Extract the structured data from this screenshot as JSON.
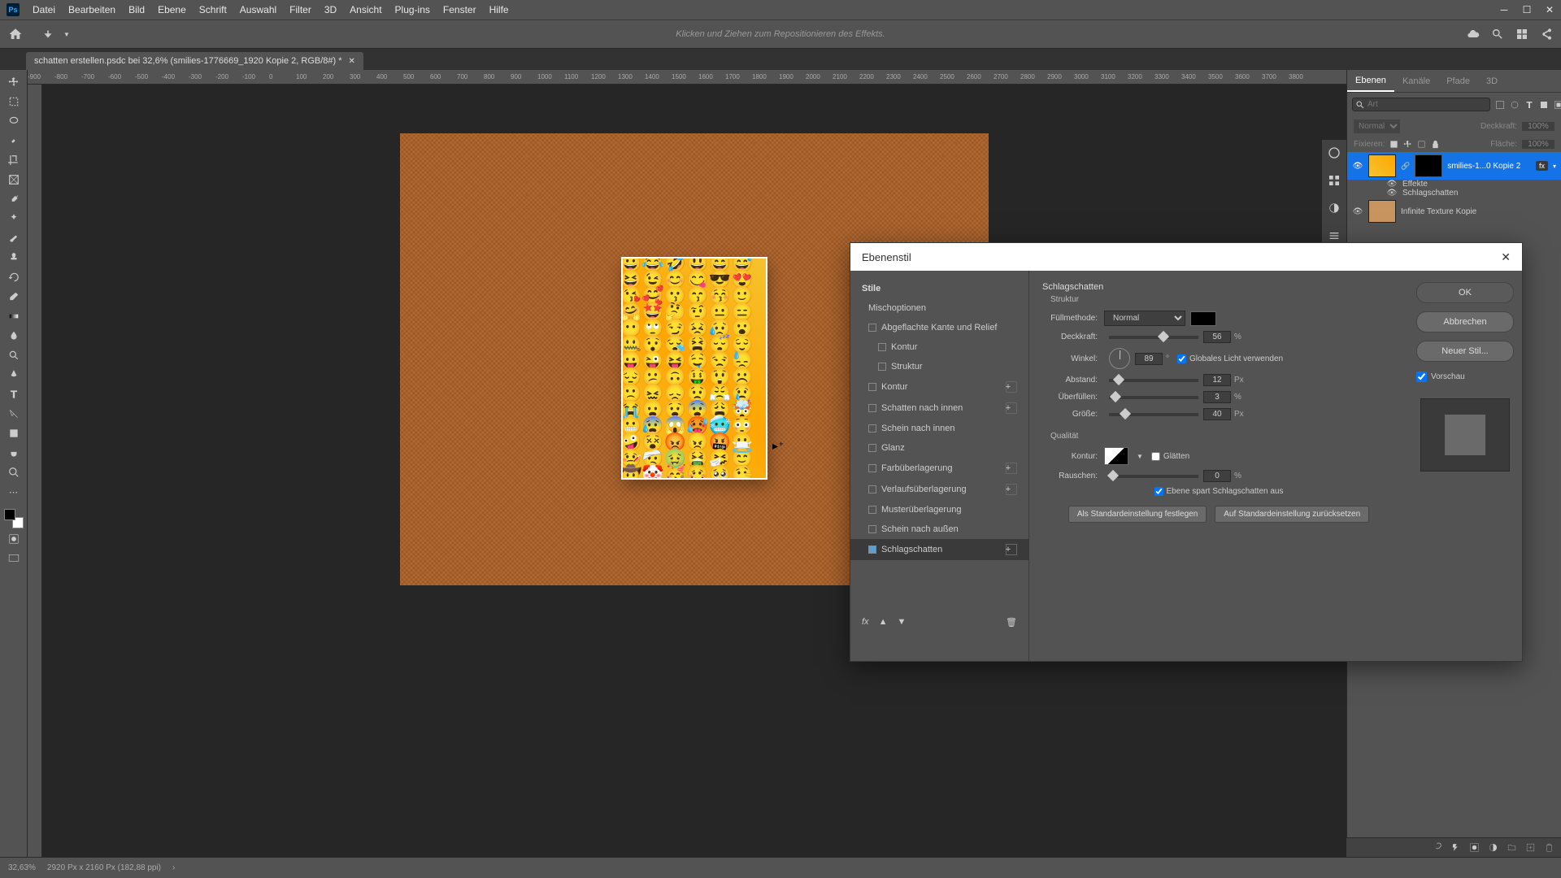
{
  "menu": {
    "items": [
      "Datei",
      "Bearbeiten",
      "Bild",
      "Ebene",
      "Schrift",
      "Auswahl",
      "Filter",
      "3D",
      "Ansicht",
      "Plug-ins",
      "Fenster",
      "Hilfe"
    ]
  },
  "hint": "Klicken und Ziehen zum Repositionieren des Effekts.",
  "doc_tab": {
    "title": "schatten erstellen.psdc bei 32,6% (smilies-1776669_1920 Kopie 2, RGB/8#) *"
  },
  "ruler_ticks": [
    "-900",
    "-800",
    "-700",
    "-600",
    "-500",
    "-400",
    "-300",
    "-200",
    "-100",
    "0",
    "100",
    "200",
    "300",
    "400",
    "500",
    "600",
    "700",
    "800",
    "900",
    "1000",
    "1100",
    "1200",
    "1300",
    "1400",
    "1500",
    "1600",
    "1700",
    "1800",
    "1900",
    "2000",
    "2100",
    "2200",
    "2300",
    "2400",
    "2500",
    "2600",
    "2700",
    "2800",
    "2900",
    "3000",
    "3100",
    "3200",
    "3300",
    "3400",
    "3500",
    "3600",
    "3700",
    "3800"
  ],
  "panels": {
    "tabs": [
      "Ebenen",
      "Kanäle",
      "Pfade",
      "3D"
    ],
    "search_placeholder": "Art",
    "blend_mode": "Normal",
    "opacity_label": "Deckkraft:",
    "opacity_value": "100%",
    "lock_label": "Fixieren:",
    "fill_label": "Fläche:",
    "fill_value": "100%",
    "layers": [
      {
        "name": "smilies-1...0 Kopie 2",
        "fx": "fx"
      },
      {
        "effect_header": "Effekte"
      },
      {
        "effect_item": "Schlagschatten"
      },
      {
        "name": "Infinite Texture Kopie"
      }
    ]
  },
  "dialog": {
    "title": "Ebenenstil",
    "left": {
      "header": "Stile",
      "mix": "Mischoptionen",
      "items": [
        {
          "label": "Abgeflachte Kante und Relief"
        },
        {
          "label": "Kontur",
          "sub": true
        },
        {
          "label": "Struktur",
          "sub": true
        },
        {
          "label": "Kontur",
          "plus": true
        },
        {
          "label": "Schatten nach innen",
          "plus": true
        },
        {
          "label": "Schein nach innen"
        },
        {
          "label": "Glanz"
        },
        {
          "label": "Farbüberlagerung",
          "plus": true
        },
        {
          "label": "Verlaufsüberlagerung",
          "plus": true
        },
        {
          "label": "Musterüberlagerung"
        },
        {
          "label": "Schein nach außen"
        },
        {
          "label": "Schlagschatten",
          "checked": true,
          "sel": true,
          "plus": true
        }
      ]
    },
    "mid": {
      "title": "Schlagschatten",
      "struct": "Struktur",
      "blend_label": "Füllmethode:",
      "blend_value": "Normal",
      "opacity_label": "Deckkraft:",
      "opacity_value": "56",
      "opacity_unit": "%",
      "angle_label": "Winkel:",
      "angle_value": "89",
      "angle_unit": "°",
      "global_light": "Globales Licht verwenden",
      "distance_label": "Abstand:",
      "distance_value": "12",
      "distance_unit": "Px",
      "spread_label": "Überfüllen:",
      "spread_value": "3",
      "spread_unit": "%",
      "size_label": "Größe:",
      "size_value": "40",
      "size_unit": "Px",
      "quality": "Qualität",
      "contour_label": "Kontur:",
      "antialias": "Glätten",
      "noise_label": "Rauschen:",
      "noise_value": "0",
      "noise_unit": "%",
      "knockout": "Ebene spart Schlagschatten aus",
      "btn_default": "Als Standardeinstellung festlegen",
      "btn_reset": "Auf Standardeinstellung zurücksetzen"
    },
    "right": {
      "ok": "OK",
      "cancel": "Abbrechen",
      "new_style": "Neuer Stil...",
      "preview": "Vorschau"
    }
  },
  "status": {
    "zoom": "32,63%",
    "dims": "2920 Px x 2160 Px (182,88 ppi)"
  }
}
